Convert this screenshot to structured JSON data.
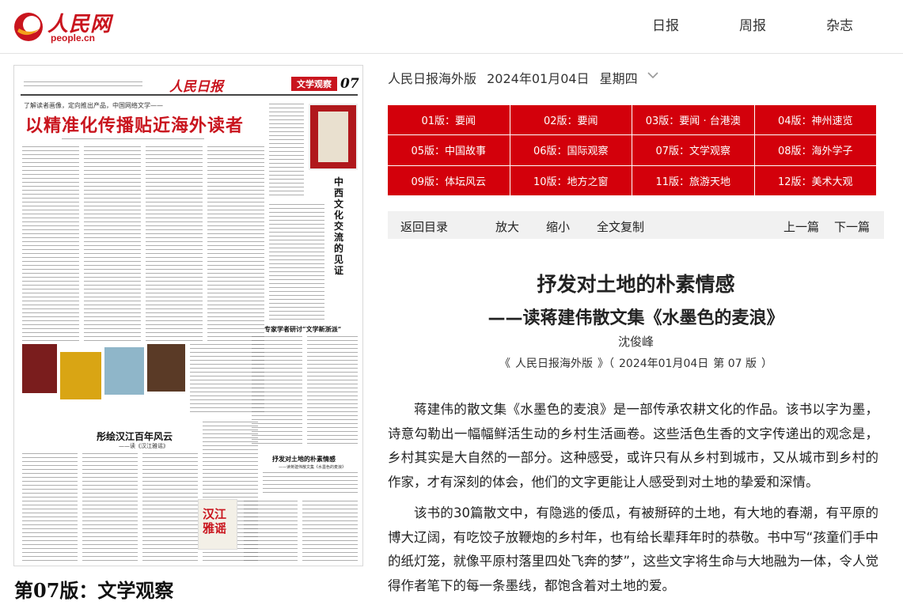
{
  "header": {
    "logo_cn": "人民网",
    "logo_en": "people.cn",
    "nav": [
      "日报",
      "周报",
      "杂志"
    ]
  },
  "edition": {
    "paper": "人民日报海外版",
    "date": "2024年01月04日",
    "weekday": "星期四"
  },
  "sections": [
    "01版：要闻",
    "02版：要闻",
    "03版：要闻 · 台港澳",
    "04版：神州速览",
    "05版：中国故事",
    "06版：国际观察",
    "07版：文学观察",
    "08版：海外学子",
    "09版：体坛风云",
    "10版：地方之窗",
    "11版：旅游天地",
    "12版：美术大观"
  ],
  "toolbar": {
    "back": "返回目录",
    "zoom_in": "放大",
    "zoom_out": "缩小",
    "copy_all": "全文复制",
    "prev": "上一篇",
    "next": "下一篇"
  },
  "article": {
    "title": "抒发对土地的朴素情感",
    "subtitle": "——读蒋建伟散文集《水墨色的麦浪》",
    "author": "沈俊峰",
    "source_open": "《",
    "source_paper": "人民日报海外版",
    "source_close": "》（",
    "source_date": "2024年01月04日",
    "source_page": "第 07 版",
    "source_end": "）",
    "paragraphs": [
      "蒋建伟的散文集《水墨色的麦浪》是一部传承农耕文化的作品。该书以字为墨，诗意勾勒出一幅幅鲜活生动的乡村生活画卷。这些活色生香的文字传递出的观念是，乡村其实是大自然的一部分。这种感受，或许只有从乡村到城市，又从城市到乡村的作家，才有深刻的体会，他们的文字更能让人感受到对土地的挚爱和深情。",
      "该书的30篇散文中，有隐逃的倭瓜，有被掰碎的土地，有大地的春潮，有平原的博大辽阔，有吃饺子放鞭炮的乡村年，也有给长辈拜年时的恭敬。书中写“孩童们手中的纸灯笼，就像平原村落里四处飞奔的梦”，这些文字将生命与大地融为一体，令人觉得作者笔下的每一条墨线，都饱含着对土地的爱。"
    ]
  },
  "newspaper": {
    "page_label": "第07版：文学观察",
    "masthead": "人民日报",
    "section_tag": "文学观察",
    "page_no": "07",
    "kicker": "了解读者画像，定向推出产品，中国网络文学——",
    "headline": "以精准化传播贴近海外读者",
    "side_title": "中西文化交流的见证",
    "lower_title": "彤绘汉江百年风云",
    "lower_sub": "——读《汉江雅谣》",
    "column_note": "专家学者研讨“文学新浙派”",
    "bottom_title": "抒发对土地的朴素情感",
    "bottom_sub": "——读蒋建伟散文集《水墨色的麦浪》",
    "book_cover": "汉江雅谣"
  },
  "colors": {
    "brand_red": "#c9151e",
    "section_red": "#d3000b",
    "toolbar_bg": "#f1f1f1"
  }
}
